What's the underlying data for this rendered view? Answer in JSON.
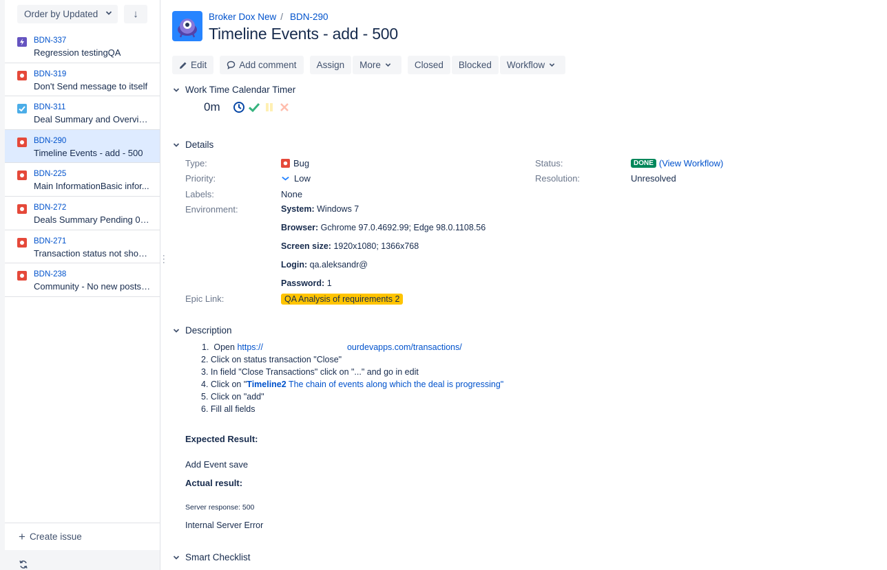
{
  "sidebar": {
    "sort_label": "Order by Updated",
    "sort_direction_glyph": "↓",
    "issues": [
      {
        "key": "BDN-337",
        "summary": "Regression testingQA",
        "type": "epic-bolt",
        "color": "#6554c0"
      },
      {
        "key": "BDN-319",
        "summary": "Don't Send message to itself",
        "type": "bug",
        "color": "#e5493a"
      },
      {
        "key": "BDN-311",
        "summary": "Deal Summary and Overvie...",
        "type": "task",
        "color": "#4bade8"
      },
      {
        "key": "BDN-290",
        "summary": "Timeline Events - add - 500",
        "type": "bug",
        "color": "#e5493a",
        "selected": true
      },
      {
        "key": "BDN-225",
        "summary": "Main InformationBasic infor...",
        "type": "bug",
        "color": "#e5493a"
      },
      {
        "key": "BDN-272",
        "summary": "Deals Summary Pending 0 -...",
        "type": "bug",
        "color": "#e5493a"
      },
      {
        "key": "BDN-271",
        "summary": "Transaction status not show...",
        "type": "bug",
        "color": "#e5493a"
      },
      {
        "key": "BDN-238",
        "summary": "Community - No new posts ...",
        "type": "bug",
        "color": "#e5493a"
      }
    ],
    "create_issue": "Create issue"
  },
  "header": {
    "project": "Broker Dox New",
    "issue_key": "BDN-290",
    "title": "Timeline Events - add - 500"
  },
  "toolbar": {
    "edit": "Edit",
    "add_comment": "Add comment",
    "assign": "Assign",
    "more": "More",
    "closed": "Closed",
    "blocked": "Blocked",
    "workflow": "Workflow"
  },
  "timer": {
    "section": "Work Time Calendar Timer",
    "value": "0m"
  },
  "details": {
    "section": "Details",
    "type_label": "Type:",
    "type_value": "Bug",
    "priority_label": "Priority:",
    "priority_value": "Low",
    "labels_label": "Labels:",
    "labels_value": "None",
    "environment_label": "Environment:",
    "env": {
      "system_key": "System:",
      "system_val": "Windows 7",
      "browser_key": "Browser:",
      "browser_val": "Gchrome 97.0.4692.99; Edge 98.0.1108.56",
      "screen_key": "Screen size:",
      "screen_val": "1920x1080; 1366x768",
      "login_key": "Login:",
      "login_val": "qa.aleksandr@",
      "password_key": "Password:",
      "password_val": "1"
    },
    "epic_label": "Epic Link:",
    "epic_value": "QA Analysis of requirements 2",
    "status_label": "Status:",
    "status_value": "DONE",
    "view_workflow": "(View Workflow)",
    "resolution_label": "Resolution:",
    "resolution_value": "Unresolved"
  },
  "description": {
    "section": "Description",
    "step1_prefix": "1.  Open ",
    "step1_link_a": "https://",
    "step1_link_b": "ourdevapps.com/transactions/",
    "step2": "2. Click on status transaction \"Close\"",
    "step3": "3. In field \"Close Transactions\" click on \"...\" and go in edit",
    "step4_prefix": "4. Click on \"",
    "step4_bold": "Timeline2",
    "step4_link": " The chain of events along which the deal is progressing",
    "step4_suffix": "\"",
    "step5": "5. Click on \"add\"",
    "step6": "6. Fill all fields",
    "expected_heading": "Expected Result:",
    "expected_text": "Add Event save",
    "actual_heading": "Actual result:",
    "server_response": "Server response: 500",
    "error_text": "Internal Server Error"
  },
  "smart_checklist": {
    "section": "Smart Checklist"
  }
}
